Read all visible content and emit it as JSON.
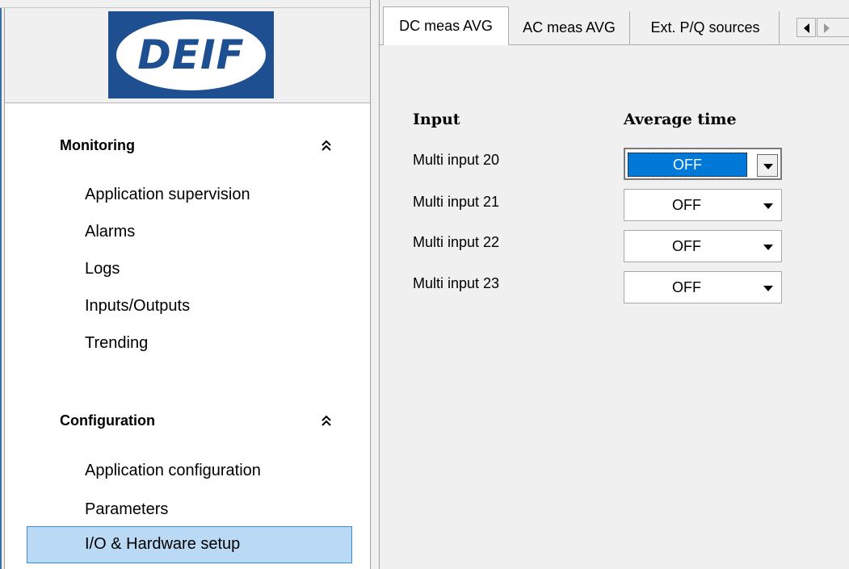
{
  "logo": {
    "text": "DEIF"
  },
  "nav": {
    "monitoring": {
      "title": "Monitoring",
      "items": [
        "Application supervision",
        "Alarms",
        "Logs",
        "Inputs/Outputs",
        "Trending"
      ]
    },
    "configuration": {
      "title": "Configuration",
      "items": [
        "Application configuration",
        "Parameters",
        "I/O & Hardware setup"
      ],
      "selected": "I/O & Hardware setup"
    }
  },
  "tabs": [
    "DC meas AVG",
    "AC meas AVG",
    "Ext. P/Q sources"
  ],
  "active_tab": "DC meas AVG",
  "table": {
    "headers": {
      "input": "Input",
      "average_time": "Average time"
    },
    "rows": [
      {
        "input": "Multi input 20",
        "average_time": "OFF"
      },
      {
        "input": "Multi input 21",
        "average_time": "OFF"
      },
      {
        "input": "Multi input 22",
        "average_time": "OFF"
      },
      {
        "input": "Multi input 23",
        "average_time": "OFF"
      }
    ]
  },
  "colors": {
    "brand": "#1d4f91",
    "selection": "#b9d9f5",
    "focus": "#0078d7"
  }
}
